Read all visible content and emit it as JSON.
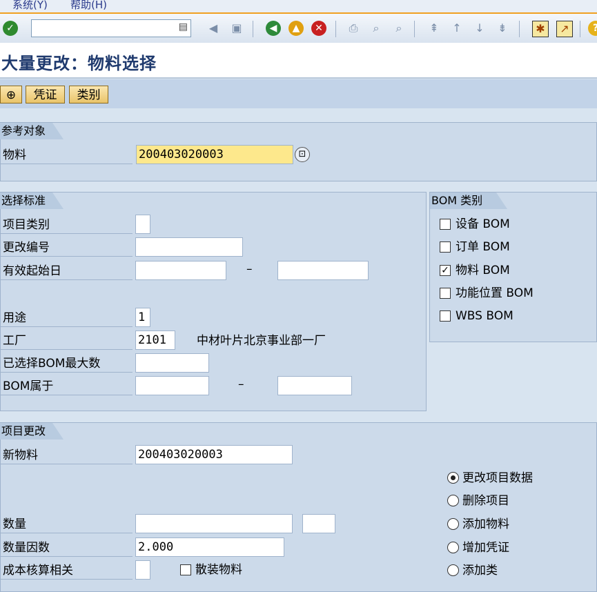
{
  "menu": {
    "system": "系统(Y)",
    "help": "帮助(H)"
  },
  "page_title": "大量更改：物料选择",
  "app_toolbar": {
    "voucher": "凭证",
    "category": "类别"
  },
  "reference": {
    "header": "参考对象",
    "material_label": "物料",
    "material_value": "200403020003"
  },
  "selection": {
    "header": "选择标准",
    "item_category_label": "项目类别",
    "change_number_label": "更改编号",
    "valid_from_label": "有效起始日",
    "usage_label": "用途",
    "usage_value": "1",
    "plant_label": "工厂",
    "plant_value": "2101",
    "plant_desc": "中材叶片北京事业部一厂",
    "max_bom_label": "已选择BOM最大数",
    "bom_belongs_label": "BOM属于",
    "dash": "–"
  },
  "bom_category": {
    "header": "BOM 类别",
    "options": [
      {
        "label": "设备 BOM",
        "checked": false
      },
      {
        "label": "订单 BOM",
        "checked": false
      },
      {
        "label": "物料 BOM",
        "checked": true
      },
      {
        "label": "功能位置 BOM",
        "checked": false
      },
      {
        "label": "WBS BOM",
        "checked": false
      }
    ]
  },
  "item_change": {
    "header": "项目更改",
    "new_material_label": "新物料",
    "new_material_value": "200403020003",
    "quantity_label": "数量",
    "quantity_factor_label": "数量因数",
    "quantity_factor_value": "2.000",
    "costing_label": "成本核算相关",
    "bulk_material_label": "散装物料",
    "actions": [
      {
        "label": "更改项目数据",
        "selected": true
      },
      {
        "label": "删除项目",
        "selected": false
      },
      {
        "label": "添加物料",
        "selected": false
      },
      {
        "label": "增加凭证",
        "selected": false
      },
      {
        "label": "添加类",
        "selected": false
      }
    ]
  }
}
